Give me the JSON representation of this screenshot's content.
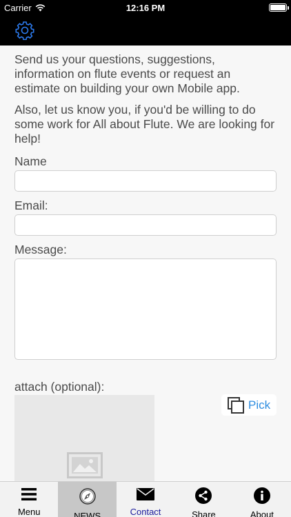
{
  "status_bar": {
    "carrier": "Carrier",
    "time": "12:16 PM",
    "battery_level": 1.0
  },
  "navbar": {
    "settings_icon": "gear-icon"
  },
  "intro": {
    "paragraph1": "Send us your questions, suggestions, information on flute events or request an estimate on building your own Mobile app.",
    "paragraph2": "Also, let us know you, if you'd be willing to do some work for All about Flute. We are looking for help!"
  },
  "form": {
    "name_label": "Name",
    "name_value": "",
    "email_label": "Email:",
    "email_value": "",
    "message_label": "Message:",
    "message_value": "",
    "attach_label": "attach (optional):",
    "pick_label": "Pick"
  },
  "tabs": [
    {
      "label": "Menu",
      "icon": "hamburger-icon"
    },
    {
      "label": "NEWS",
      "icon": "compass-icon"
    },
    {
      "label": "Contact",
      "icon": "envelope-icon"
    },
    {
      "label": "Share",
      "icon": "share-icon"
    },
    {
      "label": "About",
      "icon": "info-icon"
    }
  ],
  "colors": {
    "accent": "#2d8de0",
    "selected_tab": "#1a1a9c",
    "bar_background": "#000000"
  }
}
